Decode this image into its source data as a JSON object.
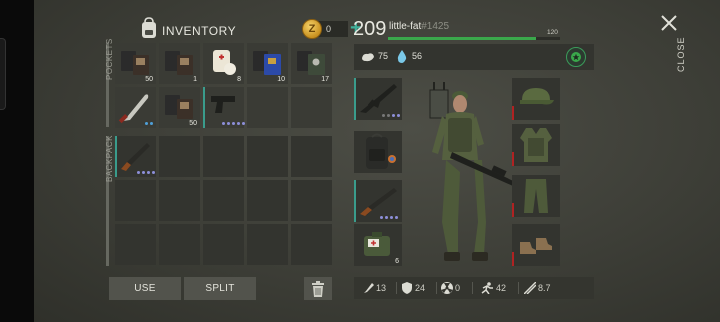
{
  "inventory": {
    "title": "INVENTORY",
    "coins": "0",
    "add_label": "+",
    "pockets_label": "POCKETS",
    "backpack_label": "BACKPACK",
    "pockets": [
      {
        "icon": "dark-book-icon",
        "count": "50"
      },
      {
        "icon": "dark-book-icon",
        "count": "1"
      },
      {
        "icon": "bandage-icon",
        "count": "8"
      },
      {
        "icon": "blue-book-icon",
        "count": "10"
      },
      {
        "icon": "green-book-icon",
        "count": "17"
      },
      {
        "icon": "machete-icon",
        "count": ""
      },
      {
        "icon": "dark-book-icon",
        "count": "50"
      },
      {
        "icon": "pistol-icon",
        "count": ""
      },
      {
        "icon": "",
        "count": ""
      },
      {
        "icon": "",
        "count": ""
      }
    ],
    "backpack_first": {
      "icon": "shotgun-icon"
    },
    "buttons": {
      "use": "USE",
      "split": "SPLIT"
    }
  },
  "player": {
    "level": "209",
    "name": "little-fat",
    "id": "#1425",
    "xp_max": "120",
    "xp_progress": 0.86,
    "hunger": "75",
    "thirst": "56"
  },
  "equipment": {
    "left": [
      {
        "icon": "assault-rifle-icon"
      },
      {
        "icon": "backpack-icon"
      },
      {
        "icon": "shotgun-icon"
      },
      {
        "icon": "medkit-icon",
        "count": "6"
      }
    ],
    "right": [
      {
        "icon": "cap-icon"
      },
      {
        "icon": "vest-icon"
      },
      {
        "icon": "pants-icon"
      },
      {
        "icon": "boots-icon"
      }
    ]
  },
  "stats": {
    "attack": "13",
    "defense": "24",
    "radiation": "0",
    "speed": "42",
    "weight": "8.7"
  },
  "close_label": "CLOSE",
  "colors": {
    "accent": "#3fb09a",
    "xp": "#3aa84b",
    "coin": "#e0b040",
    "wear": "#b02222"
  }
}
